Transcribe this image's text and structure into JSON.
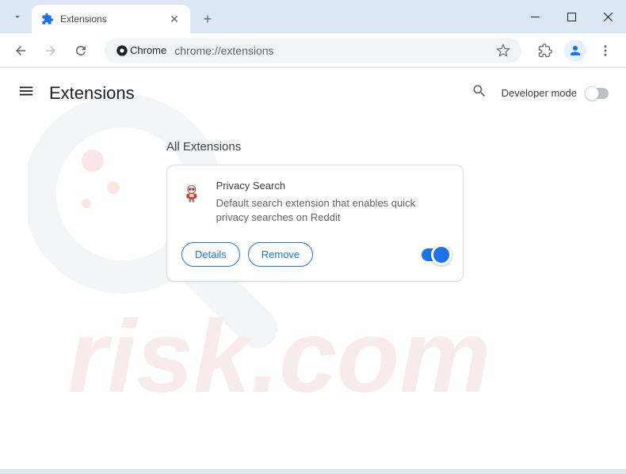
{
  "tab": {
    "title": "Extensions"
  },
  "omnibox": {
    "chip": "Chrome",
    "url": "chrome://extensions"
  },
  "page": {
    "title": "Extensions",
    "developer_mode_label": "Developer mode",
    "section_title": "All Extensions"
  },
  "extension": {
    "name": "Privacy Search",
    "description": "Default search extension that enables quick privacy searches on Reddit",
    "details_label": "Details",
    "remove_label": "Remove"
  },
  "watermark": "pcrisk.com"
}
